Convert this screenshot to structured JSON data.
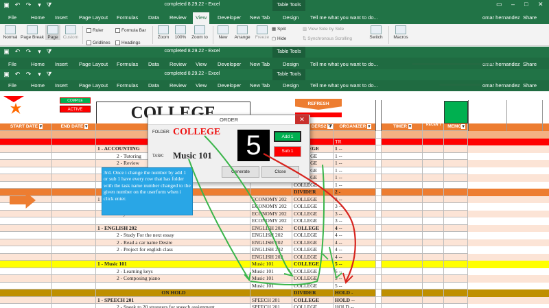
{
  "windows": [
    {
      "title": "completed 8.29.22 - Excel",
      "tools": "Table Tools",
      "user": "omar hernandez",
      "share": "Share",
      "tell": "Tell me what you want to do...",
      "menu": [
        "File",
        "Home",
        "Insert",
        "Page Layout",
        "Formulas",
        "Data",
        "Review",
        "View",
        "Developer",
        "New Tab",
        "Design"
      ],
      "selected": "View"
    },
    {
      "title": "completed 8.29.22 - Excel",
      "tools": "Table Tools",
      "user": "omar hernandez",
      "share": "Share",
      "tell": "Tell me what you want to do...",
      "menu": [
        "File",
        "Home",
        "Insert",
        "Page Layout",
        "Formulas",
        "Data",
        "Review",
        "View",
        "Developer",
        "New Tab",
        "Design"
      ]
    },
    {
      "title": "completed 8.29.22 - Excel",
      "tools": "Table Tools",
      "user": "omar hernandez",
      "share": "Share",
      "tell": "Tell me what you want to do...",
      "menu": [
        "File",
        "Home",
        "Insert",
        "Page Layout",
        "Formulas",
        "Data",
        "Review",
        "View",
        "Developer",
        "New Tab",
        "Design"
      ]
    }
  ],
  "ribbon": {
    "normal": "Normal",
    "page_break": "Page Break",
    "page": "Page",
    "custom": "Custom",
    "ruler": "Ruler",
    "formula_bar": "Formula Bar",
    "gridlines": "Gridlines",
    "headings": "Headings",
    "zoom": "Zoom",
    "zoom100": "100%",
    "zoom_to": "Zoom to",
    "new": "New",
    "arrange": "Arrange",
    "freeze": "Freeze",
    "split": "Split",
    "hide": "Hide",
    "side_by_side": "View Side by Side",
    "sync_scroll": "Synchronous Scrolling",
    "switch": "Switch",
    "macros": "Macros"
  },
  "sheet": {
    "compile_btn": "COMPILE",
    "active_btn": "ACTIVE",
    "refresh_btn": "REFRESH",
    "title": "COLLEGE",
    "headers": {
      "start": "START DATE",
      "end": "END DATE",
      "folders": "DERS2",
      "organizer": "ORGANIZER",
      "timer": "TIMER",
      "recent": "RECEN T",
      "memo": "MEMO"
    },
    "rows": [
      {
        "c": "#f4b183",
        "task": "",
        "course": "",
        "folder": "",
        "org": "",
        "red": false
      },
      {
        "c": "#ff0000",
        "task": "",
        "course": "",
        "folder": "",
        "org": "TR",
        "red": true
      },
      {
        "c": "#fce4d6",
        "task": "1 - ACCOUNTING",
        "course": "",
        "folder": "COLLEGE",
        "org": "1 --",
        "bold": true
      },
      {
        "c": "#ffffff",
        "task": "2 - Tutoring",
        "course": "",
        "folder": "COLLEGE",
        "org": "1 --",
        "indent": true
      },
      {
        "c": "#fce4d6",
        "task": "2 - Review",
        "course": "",
        "folder": "COLLEGE",
        "org": "1 --",
        "indent": true
      },
      {
        "c": "#ffffff",
        "task": "2 - Read ch",
        "course": "",
        "folder": "COLLEGE",
        "org": "1 --",
        "indent": true
      },
      {
        "c": "#fce4d6",
        "task": "",
        "course": "",
        "folder": "COLLEGE",
        "org": "1 --"
      },
      {
        "c": "#ffffff",
        "task": "",
        "course": "",
        "folder": "COLLEGE",
        "org": "1 --"
      },
      {
        "c": "#ed7d31",
        "task": "",
        "course": "",
        "folder": "DIVIDER",
        "org": "2 -",
        "bold": true
      },
      {
        "c": "#fce4d6",
        "task": "1",
        "course": "ECONOMY 202",
        "folder": "COLLEGE",
        "org": "3 --"
      },
      {
        "c": "#ffffff",
        "task": "sion in the US",
        "course": "ECONOMY 202",
        "folder": "COLLEGE",
        "org": "3 --",
        "indent": true
      },
      {
        "c": "#fce4d6",
        "task": "omy in the 1990",
        "course": "ECONOMY 202",
        "folder": "COLLEGE",
        "org": "3 --",
        "indent": true
      },
      {
        "c": "#ffffff",
        "task": "",
        "course": "ECONOMY 202",
        "folder": "COLLEGE",
        "org": "3 --"
      },
      {
        "c": "#fce4d6",
        "task": "1 - ENGLISH 202",
        "course": "ENGLISH 202",
        "folder": "COLLEGE",
        "org": "4 --",
        "bold": true
      },
      {
        "c": "#ffffff",
        "task": "2 - Study For the next essay",
        "course": "ENGLISH 202",
        "folder": "COLLEGE",
        "org": "4 --",
        "indent": true
      },
      {
        "c": "#fce4d6",
        "task": "2 - Read a car name Desire",
        "course": "ENGLISH 202",
        "folder": "COLLEGE",
        "org": "4 --",
        "indent": true
      },
      {
        "c": "#ffffff",
        "task": "2 - Project for english class",
        "course": "ENGLISH 202",
        "folder": "COLLEGE",
        "org": "4 --",
        "indent": true
      },
      {
        "c": "#fce4d6",
        "task": "",
        "course": "ENGLISH 202",
        "folder": "COLLEGE",
        "org": "4 --"
      },
      {
        "c": "#ffff00",
        "task": "1 - Music 101",
        "course": "Music 101",
        "folder": "COLLEGE",
        "org": "5 --",
        "bold": true
      },
      {
        "c": "#ffffff",
        "task": "2 - Learning keys",
        "course": "Music 101",
        "folder": "COLLEGE",
        "org": "5 --",
        "indent": true
      },
      {
        "c": "#fce4d6",
        "task": "2 - Composing piano",
        "course": "Music 101",
        "folder": "COLLEGE",
        "org": "5 --",
        "indent": true
      },
      {
        "c": "#ffffff",
        "task": "",
        "course": "Music 101",
        "folder": "COLLEGE",
        "org": "5 --"
      },
      {
        "c": "#bf8f00",
        "task": "ON HOLD",
        "course": "",
        "folder": "DIVIDER",
        "org": "HOLD -",
        "bold": true,
        "center": true
      },
      {
        "c": "#fce4d6",
        "task": "1 - SPEECH 201",
        "course": "SPEECH 201",
        "folder": "COLLEGE",
        "org": "HOLD --",
        "bold": true
      },
      {
        "c": "#ffffff",
        "task": "2 - Speek to 20 strangers for speech assignment",
        "course": "SPEECH 201",
        "folder": "COLLEGE",
        "org": "HOLD --",
        "indent": true
      }
    ]
  },
  "dialog": {
    "title": "ORDER",
    "folder_label": "FOLDER:",
    "folder_value": "COLLEGE",
    "task_label": "TASK:",
    "task_value": "Music 101",
    "number": "5",
    "add_label": "Add 1",
    "sub_label": "Sub 1",
    "generate": "Generate",
    "close": "Close",
    "close_x": "✕"
  },
  "note": "3rd. Once i change the number by add 1 or sub 1 have every row that has folder with the task name number changed to the given number on the userform when i click enter.",
  "colors": {
    "excel_green": "#217346",
    "header_orange": "#ed7d31",
    "green_arrow": "#3ab54a",
    "red_arrow": "#d6241e"
  }
}
